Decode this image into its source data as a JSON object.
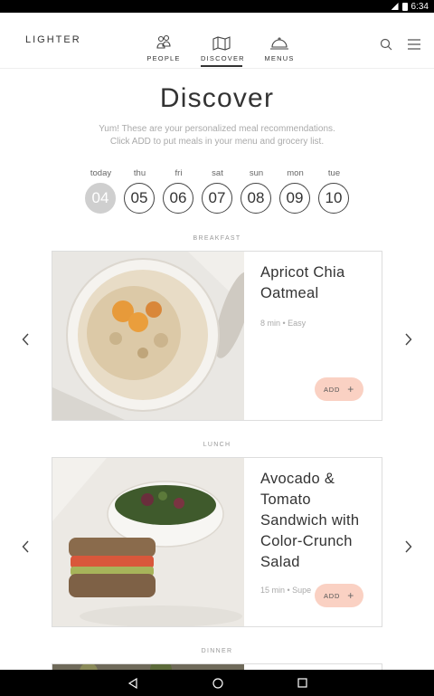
{
  "status_bar": {
    "time": "6:34"
  },
  "header": {
    "brand": "LIGHTER",
    "nav": [
      {
        "label": "PEOPLE",
        "icon": "people-icon"
      },
      {
        "label": "DISCOVER",
        "icon": "map-icon"
      },
      {
        "label": "MENUS",
        "icon": "cloche-icon"
      }
    ],
    "active_nav": "DISCOVER"
  },
  "page": {
    "title": "Discover",
    "subtitle_line1": "Yum! These are your personalized meal recommendations.",
    "subtitle_line2": "Click ADD to put meals in your menu and grocery list."
  },
  "days": [
    {
      "name": "today",
      "num": "04",
      "selected": true
    },
    {
      "name": "thu",
      "num": "05"
    },
    {
      "name": "fri",
      "num": "06"
    },
    {
      "name": "sat",
      "num": "07"
    },
    {
      "name": "sun",
      "num": "08"
    },
    {
      "name": "mon",
      "num": "09"
    },
    {
      "name": "tue",
      "num": "10"
    }
  ],
  "meals": {
    "breakfast": {
      "label": "BREAKFAST",
      "title_line1": "Apricot Chia",
      "title_line2": "Oatmeal",
      "meta": "8 min • Easy",
      "add_label": "ADD"
    },
    "lunch": {
      "label": "LUNCH",
      "title_line1": "Avocado &",
      "title_line2": "Tomato",
      "title_line3": "Sandwich with",
      "title_line4": "Color-Crunch",
      "title_line5": "Salad",
      "meta": "15 min • Supe",
      "add_label": "ADD"
    },
    "dinner": {
      "label": "DINNER"
    }
  },
  "colors": {
    "accent": "#fad1c3",
    "selected_day": "#cfcfcf",
    "text": "#333333"
  }
}
